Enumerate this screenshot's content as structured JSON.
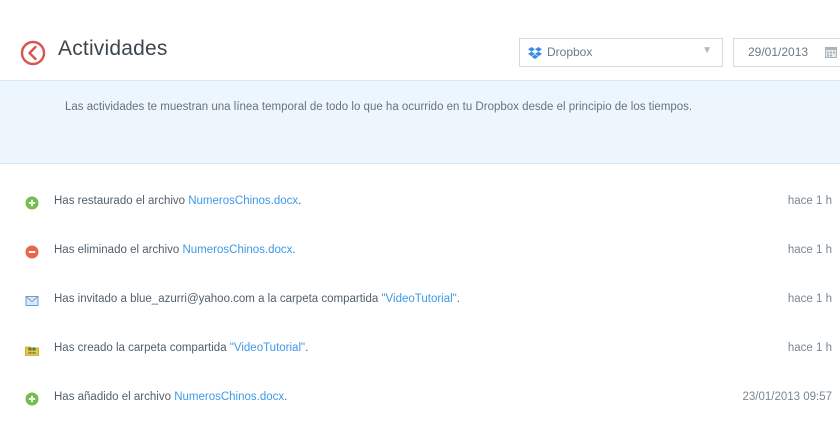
{
  "header": {
    "title": "Actividades",
    "title_icon": "clock-back-icon",
    "filter_select": {
      "selected": "Dropbox",
      "icon": "dropbox-icon"
    },
    "date_field": {
      "value": "29/01/2013",
      "icon": "calendar-icon"
    }
  },
  "info": {
    "text": "Las actividades te muestran una línea temporal de todo lo que ha ocurrido en tu Dropbox desde el principio de los tiempos."
  },
  "activities": [
    {
      "icon": "plus-icon",
      "prefix": "Has restaurado el archivo ",
      "link": "NumerosChinos.docx",
      "suffix": ".",
      "time": "hace 1 h"
    },
    {
      "icon": "minus-icon",
      "prefix": "Has eliminado el archivo ",
      "link": "NumerosChinos.docx",
      "suffix": ".",
      "time": "hace 1 h"
    },
    {
      "icon": "envelope-icon",
      "prefix": "Has invitado a blue_azurri@yahoo.com a la carpeta compartida ",
      "link": "\"VideoTutorial\"",
      "suffix": ".",
      "time": "hace 1 h"
    },
    {
      "icon": "shared-folder-icon",
      "prefix": "Has creado la carpeta compartida ",
      "link": "\"VideoTutorial\"",
      "suffix": ".",
      "time": "hace 1 h"
    },
    {
      "icon": "plus-icon",
      "prefix": "Has añadido el archivo ",
      "link": "NumerosChinos.docx",
      "suffix": ".",
      "time": "23/01/2013 09:57"
    }
  ],
  "colors": {
    "accent": "#d9534f",
    "link": "#3d9ae8",
    "green": "#6fbf4b",
    "red": "#e8654d",
    "info_bg": "#eef6fd",
    "dropbox_blue": "#3a8be6"
  }
}
